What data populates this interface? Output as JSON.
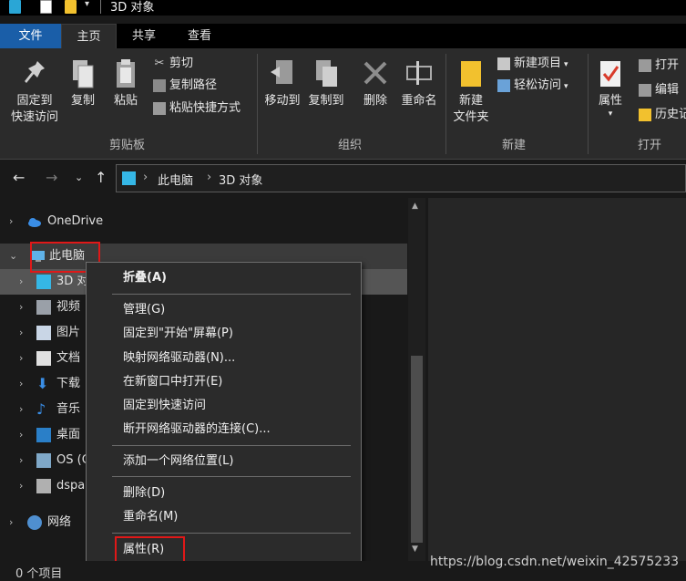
{
  "window": {
    "title": "3D 对象"
  },
  "tabs": [
    {
      "label": "文件"
    },
    {
      "label": "主页"
    },
    {
      "label": "共享"
    },
    {
      "label": "查看"
    }
  ],
  "ribbon": {
    "clipboard": {
      "pin_quick_access_line1": "固定到",
      "pin_quick_access_line2": "快速访问",
      "copy": "复制",
      "paste": "粘贴",
      "cut": "剪切",
      "copy_path": "复制路径",
      "paste_shortcut": "粘贴快捷方式",
      "group_label": "剪贴板"
    },
    "organize": {
      "move_to": "移动到",
      "copy_to": "复制到",
      "delete": "删除",
      "rename": "重命名",
      "group_label": "组织"
    },
    "new": {
      "new_folder_line1": "新建",
      "new_folder_line2": "文件夹",
      "new_item": "新建项目",
      "easy_access": "轻松访问",
      "group_label": "新建"
    },
    "open": {
      "properties": "属性",
      "open": "打开",
      "edit": "编辑",
      "history": "历史记",
      "group_label": "打开"
    }
  },
  "address": {
    "crumb1": "此电脑",
    "crumb2": "3D 对象"
  },
  "nav": {
    "onedrive": "OneDrive",
    "this_pc": "此电脑",
    "objects3d": "3D 对",
    "videos": "视频",
    "pictures": "图片",
    "documents": "文档",
    "downloads": "下载",
    "music": "音乐",
    "desktop": "桌面",
    "os_drive": "OS (C",
    "dspa": "dspa",
    "network": "网络"
  },
  "context_menu": {
    "collapse": "折叠(A)",
    "manage": "管理(G)",
    "pin_start": "固定到\"开始\"屏幕(P)",
    "map_drive": "映射网络驱动器(N)...",
    "open_new_window": "在新窗口中打开(E)",
    "pin_quick": "固定到快速访问",
    "disconnect_drive": "断开网络驱动器的连接(C)...",
    "add_network_location": "添加一个网络位置(L)",
    "delete": "删除(D)",
    "rename": "重命名(M)",
    "properties": "属性(R)"
  },
  "status": {
    "count": "0 个项目"
  },
  "watermark": "https://blog.csdn.net/weixin_42575233",
  "colors": {
    "file_tab": "#1a5ea8",
    "highlight_box": "#e01818",
    "folder": "#f2c12e"
  }
}
